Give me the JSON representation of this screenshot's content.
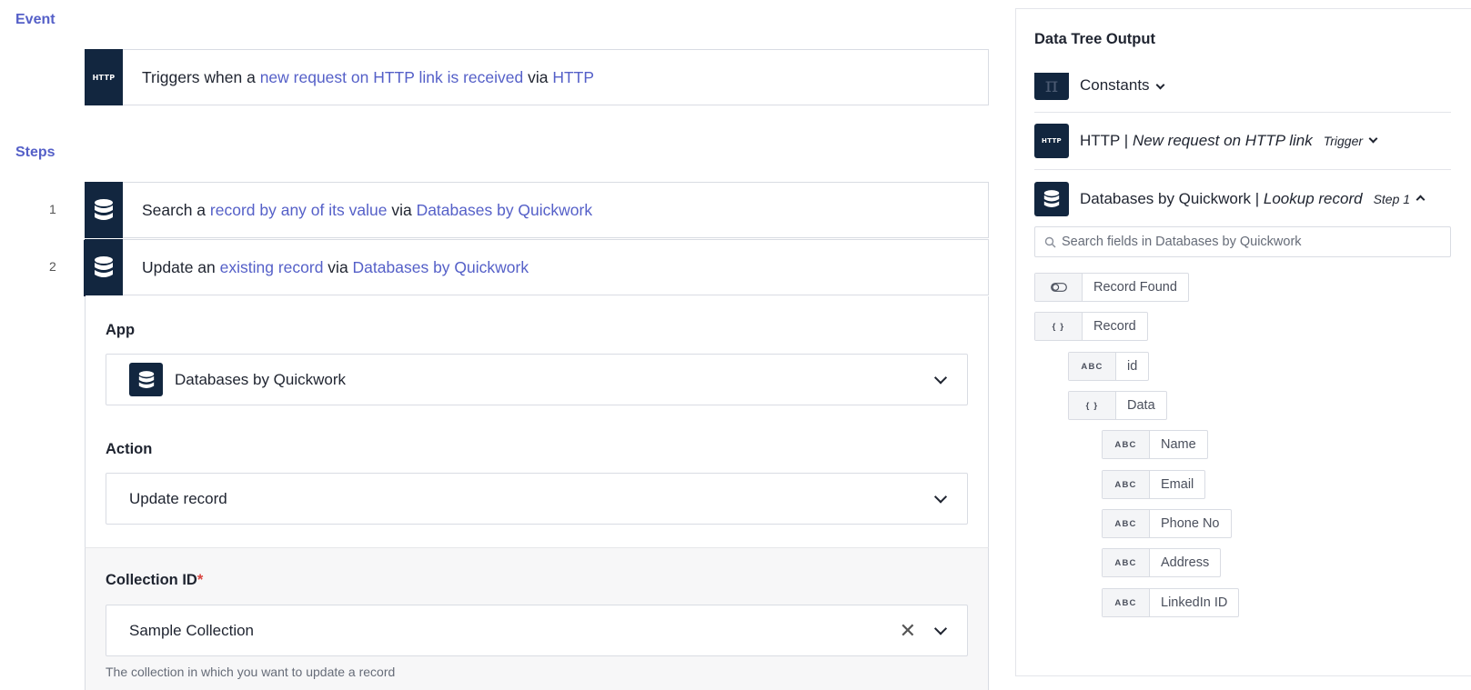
{
  "event": {
    "section_label": "Event",
    "icon": "http-icon",
    "icon_text": "HTTP",
    "prefix": "Triggers when a ",
    "link1": "new request on HTTP link is received",
    "via": " via ",
    "link2": "HTTP"
  },
  "steps": {
    "section_label": "Steps",
    "items": [
      {
        "number": "1",
        "prefix": "Search a ",
        "link1": "record by any of its value",
        "via": " via ",
        "link2": "Databases by Quickwork"
      },
      {
        "number": "2",
        "prefix": "Update an ",
        "link1": "existing record",
        "via": " via ",
        "link2": "Databases by Quickwork"
      }
    ]
  },
  "form": {
    "app_label": "App",
    "app_value": "Databases by Quickwork",
    "action_label": "Action",
    "action_value": "Update record",
    "collection_label": "Collection ID",
    "collection_required": "*",
    "collection_value": "Sample Collection",
    "collection_help": "The collection in which you want to update a record",
    "clear_symbol": "✕"
  },
  "data_tree": {
    "title": "Data Tree Output",
    "constants_label": "Constants",
    "http_icon_text": "HTTP",
    "http_app": "HTTP | ",
    "http_event": "New request on HTTP link",
    "http_badge": "Trigger",
    "db_app": "Databases by Quickwork | ",
    "db_event": "Lookup record",
    "db_badge": "Step 1",
    "search_placeholder": "Search fields in Databases by Quickwork",
    "fields": [
      {
        "type": "toggle",
        "name": "Record Found"
      },
      {
        "type": "{ }",
        "name": "Record"
      },
      {
        "type": "ABC",
        "name": "id"
      },
      {
        "type": "{ }",
        "name": "Data"
      },
      {
        "type": "ABC",
        "name": "Name"
      },
      {
        "type": "ABC",
        "name": "Email"
      },
      {
        "type": "ABC",
        "name": "Phone No"
      },
      {
        "type": "ABC",
        "name": "Address"
      },
      {
        "type": "ABC",
        "name": "LinkedIn ID"
      }
    ]
  },
  "colors": {
    "accent": "#5560c8",
    "icon_bg": "#12263f",
    "required": "#d9433f"
  }
}
